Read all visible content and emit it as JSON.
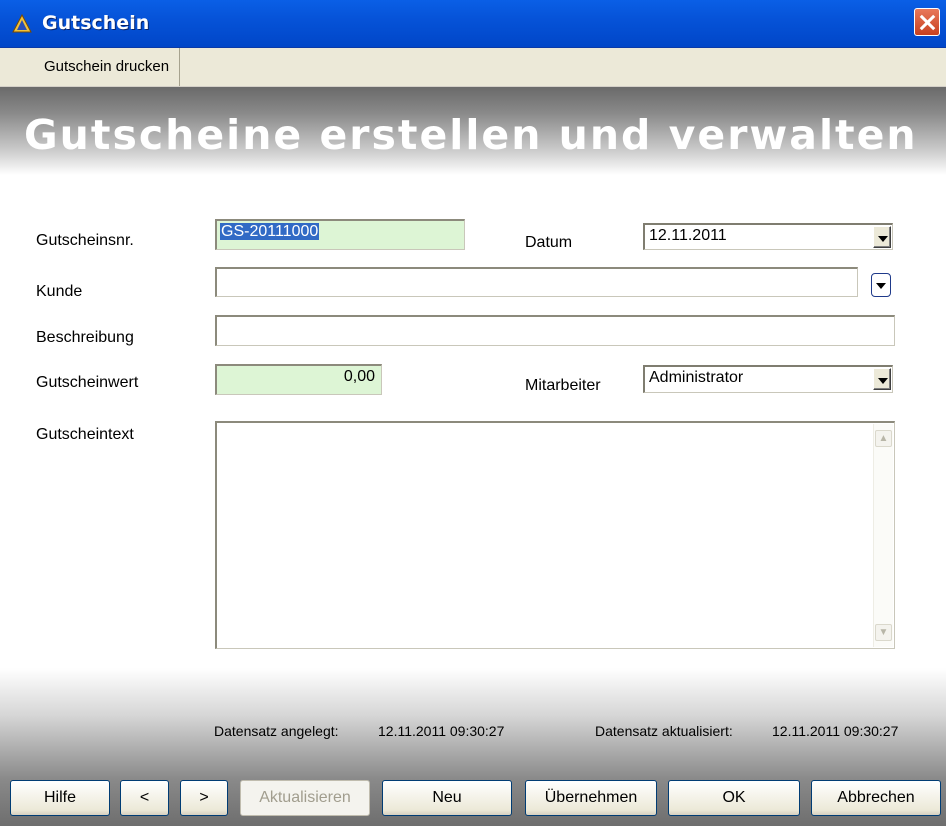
{
  "window": {
    "title": "Gutschein",
    "close_icon": "close-icon",
    "app_icon": "app-icon"
  },
  "menu": {
    "items": [
      {
        "label": "Gutschein drucken"
      }
    ]
  },
  "header": {
    "title": "Gutscheine erstellen und verwalten"
  },
  "form": {
    "gutscheinsnr": {
      "label": "Gutscheinsnr.",
      "value": "GS-20111000"
    },
    "datum": {
      "label": "Datum",
      "value": "12.11.2011"
    },
    "kunde": {
      "label": "Kunde",
      "value": ""
    },
    "beschreibung": {
      "label": "Beschreibung",
      "value": ""
    },
    "gutscheinwert": {
      "label": "Gutscheinwert",
      "value": "0,00"
    },
    "mitarbeiter": {
      "label": "Mitarbeiter",
      "value": "Administrator"
    },
    "gutscheintext": {
      "label": "Gutscheintext",
      "value": ""
    }
  },
  "status": {
    "created_label": "Datensatz angelegt:",
    "created_value": "12.11.2011 09:30:27",
    "updated_label": "Datensatz aktualisiert:",
    "updated_value": "12.11.2011 09:30:27"
  },
  "buttons": {
    "help": "Hilfe",
    "prev": "<",
    "next": ">",
    "refresh": "Aktualisieren",
    "new": "Neu",
    "apply": "Übernehmen",
    "ok": "OK",
    "cancel": "Abbrechen"
  },
  "colors": {
    "titlebar": "#0653d8",
    "highlight_field": "#ddf5d5",
    "selection": "#316ac5"
  }
}
